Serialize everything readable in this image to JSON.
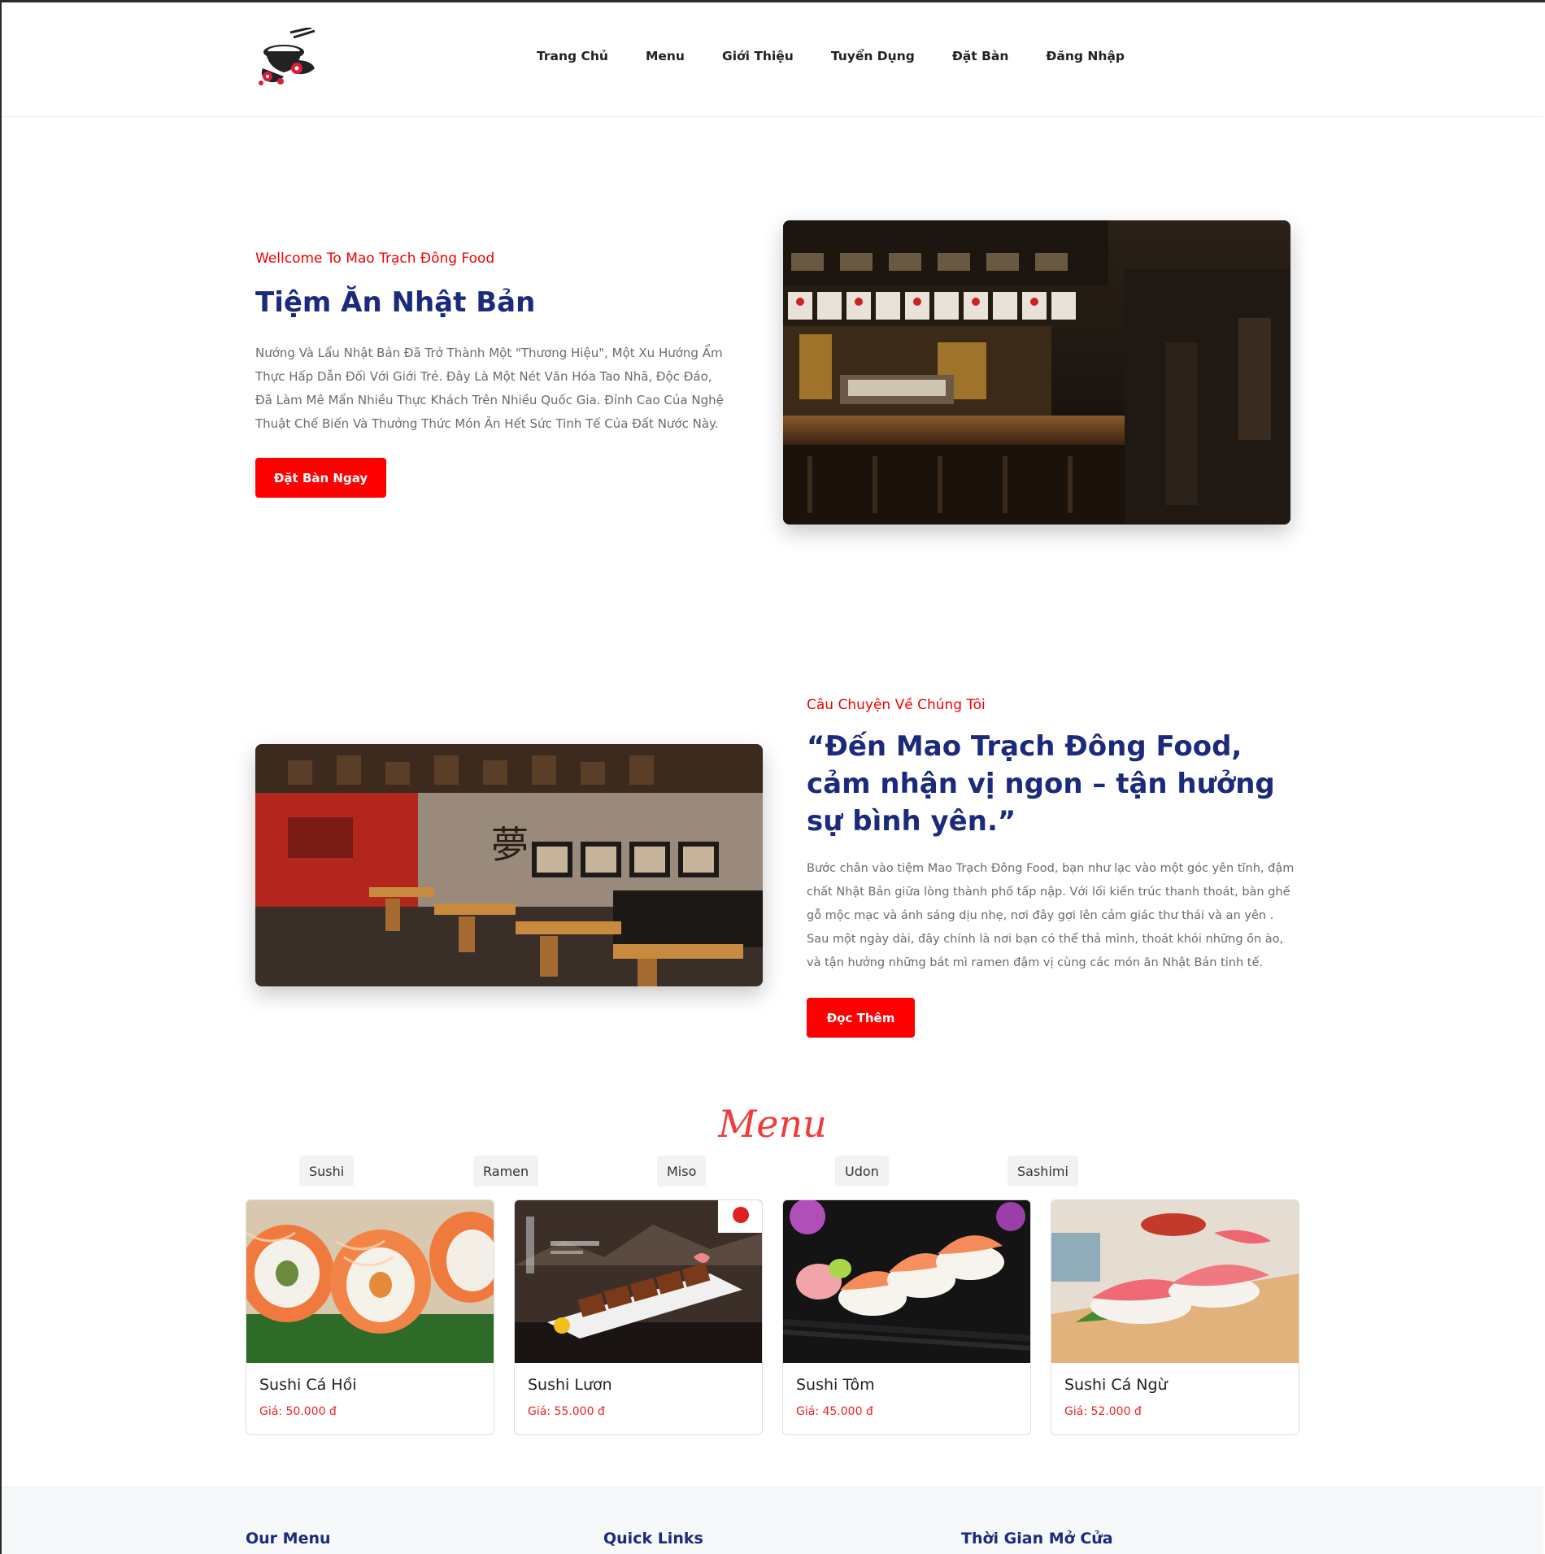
{
  "header": {
    "logo_name": "ramen-bowl-logo",
    "nav": [
      "Trang Chủ",
      "Menu",
      "Giới Thiệu",
      "Tuyển Dụng",
      "Đặt Bàn",
      "Đăng Nhập"
    ]
  },
  "hero": {
    "subtitle": "Wellcome To Mao Trạch Đông Food",
    "title": "Tiệm Ăn Nhật Bản",
    "text": "Nướng Và Lẩu Nhật Bản Đã Trở Thành Một \"Thương Hiệu\", Một Xu Hướng Ẩm Thực Hấp Dẫn Đối Với Giới Trẻ. Đây Là Một Nét Văn Hóa Tao Nhã, Độc Đáo, Đã Làm Mê Mẩn Nhiều Thực Khách Trên Nhiều Quốc Gia. Đỉnh Cao Của Nghệ Thuật Chế Biến Và Thưởng Thức Món Ăn Hết Sức Tinh Tế Của Đất Nước Này.",
    "button": "Đặt Bàn Ngay"
  },
  "story": {
    "subtitle": "Câu Chuyện Về Chúng Tôi",
    "title": "“Đến Mao Trạch Đông Food, cảm nhận vị ngon – tận hưởng sự bình yên.”",
    "text": "Bước chân vào tiệm Mao Trạch Đông Food, bạn như lạc vào một góc yên tĩnh, đậm chất Nhật Bản giữa lòng thành phố tấp nập. Với lối kiến trúc thanh thoát, bàn ghế gỗ mộc mạc và ánh sáng dịu nhẹ, nơi đây gợi lên cảm giác thư thái và an yên . Sau một ngày dài, đây chính là nơi bạn có thể thả mình, thoát khỏi những ồn ào, và tận hưởng những bát mì ramen đậm vị cùng các món ăn Nhật Bản tinh tế.",
    "button": "Đọc Thêm"
  },
  "menu": {
    "title": "Menu",
    "tabs": [
      "Sushi",
      "Ramen",
      "Miso",
      "Udon",
      "Sashimi"
    ],
    "items": [
      {
        "name": "Sushi Cá Hồi",
        "price": "Giá: 50.000 đ"
      },
      {
        "name": "Sushi Lươn",
        "price": "Giá: 55.000 đ"
      },
      {
        "name": "Sushi Tôm",
        "price": "Giá: 45.000 đ"
      },
      {
        "name": "Sushi Cá Ngừ",
        "price": "Giá: 52.000 đ"
      }
    ]
  },
  "footer": {
    "headings": [
      "Our Menu",
      "Quick Links",
      "Thời Gian Mở Cửa"
    ]
  },
  "colors": {
    "accent": "#ff0000",
    "heading": "#1b2a7c",
    "menu_title": "#ef3b3b"
  }
}
